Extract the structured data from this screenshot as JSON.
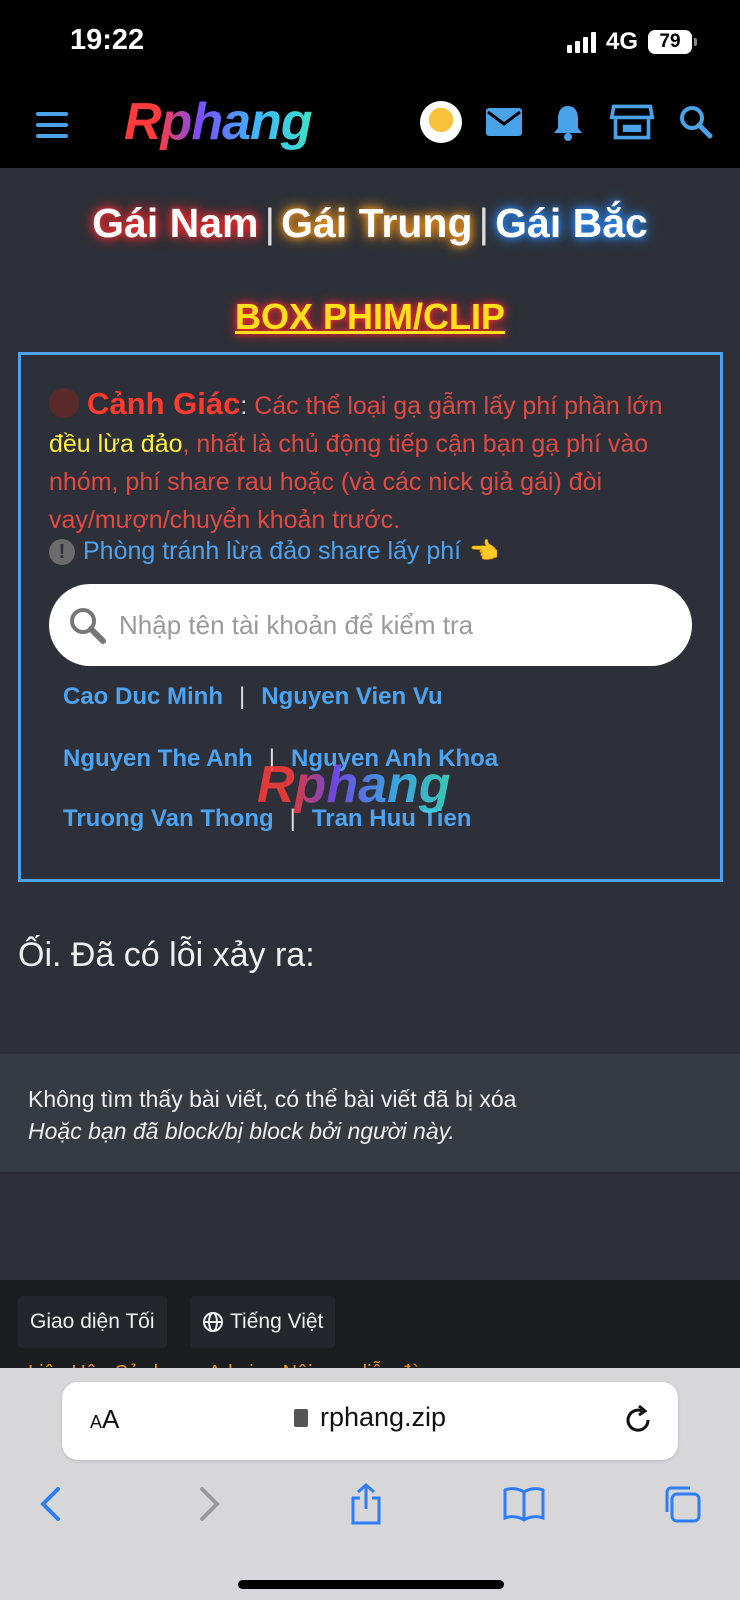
{
  "status_bar": {
    "time": "19:22",
    "network": "4G",
    "battery": "79"
  },
  "nav": {
    "logo": "Rphang",
    "icons": [
      "menu-icon",
      "avatar",
      "mail-icon",
      "bell-icon",
      "store-icon",
      "search-icon"
    ]
  },
  "regions": [
    "Gái Nam",
    "Gái Trung",
    "Gái Bắc"
  ],
  "regions_sep": "|",
  "box_title": "BOX PHIM/CLIP",
  "warning": {
    "headline": "Cảnh Giác",
    "colon": ":",
    "text_before": " Các thể loại gạ gẫm lấy phí phần lớn ",
    "highlight": "đều lừa đảo",
    "text_after": ", nhất là chủ động tiếp cận bạn gạ phí vào nhóm, phí share rau hoặc (và các nick giả gái) đòi vay/mượn/chuyển khoản trước.",
    "tip": "Phòng tránh lừa đảo share lấy phí",
    "tip_excl": "!",
    "tip_hand": "👈",
    "search_placeholder": "Nhập tên tài khoản để kiểm tra",
    "names": [
      [
        "Cao Duc Minh",
        "Nguyen Vien Vu"
      ],
      [
        "Nguyen The Anh",
        "Nguyen Anh Khoa"
      ],
      [
        "Truong Van Thong",
        "Tran Huu Tien"
      ]
    ],
    "pipe": "|",
    "watermark": "Rphang"
  },
  "error": {
    "title": "Ối. Đã có lỗi xảy ra:",
    "line1": "Không tìm thấy bài viết, có thể bài viết đã bị xóa",
    "line2": "Hoặc bạn đã block/bị block bởi người này."
  },
  "footer": {
    "theme_button": "Giao diện Tối",
    "language_button": "Tiếng Việt",
    "links_partial": "Liên Hệ · Sử dụng · Admin · Nội quy diễn đàn"
  },
  "browser": {
    "aa_small": "A",
    "aa_big": "A",
    "url": "rphang.zip",
    "toolbar": [
      "back-icon",
      "forward-icon",
      "share-icon",
      "bookmarks-icon",
      "tabs-icon"
    ]
  },
  "colors": {
    "accent_blue": "#4ea3f0",
    "warning_red": "#e04a43",
    "highlight_yellow": "#ffee3a",
    "box_title_yellow": "#ffe01a"
  }
}
